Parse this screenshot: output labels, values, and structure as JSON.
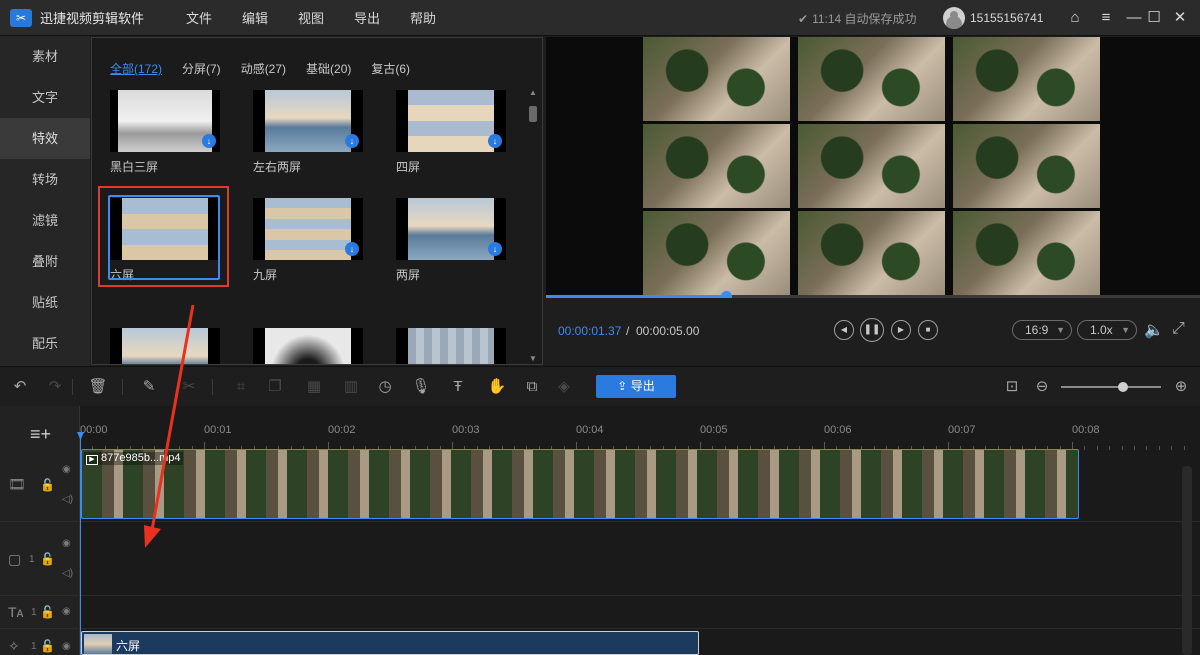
{
  "app": {
    "title": "迅捷视频剪辑软件"
  },
  "menu": [
    "文件",
    "编辑",
    "视图",
    "导出",
    "帮助"
  ],
  "status": {
    "save_time": "11:14",
    "save_text": "自动保存成功"
  },
  "user": {
    "name": "15155156741"
  },
  "sidebar": {
    "items": [
      "素材",
      "文字",
      "特效",
      "转场",
      "滤镜",
      "叠附",
      "贴纸",
      "配乐"
    ],
    "active_index": 2
  },
  "effects": {
    "tabs": [
      "全部(172)",
      "分屏(7)",
      "动感(27)",
      "基础(20)",
      "复古(6)"
    ],
    "active_tab": 0,
    "items": [
      {
        "label": "黑白三屏",
        "downloadable": true
      },
      {
        "label": "左右两屏",
        "downloadable": true
      },
      {
        "label": "四屏",
        "downloadable": true
      },
      {
        "label": "六屏",
        "downloadable": false,
        "selected": true
      },
      {
        "label": "九屏",
        "downloadable": true
      },
      {
        "label": "两屏",
        "downloadable": true
      }
    ]
  },
  "player": {
    "current_time": "00:00:01.37",
    "separator": "/",
    "total_time": "00:00:05.00",
    "progress_fraction": 0.275,
    "aspect_ratio": "16:9",
    "speed": "1.0x"
  },
  "toolbar": {
    "export_label": "导出",
    "zoom_level_fraction": 0.62,
    "accent_color": "#2a7ae0"
  },
  "timeline": {
    "ruler_labels": [
      "00:00",
      "00:01",
      "00:02",
      "00:03",
      "00:04",
      "00:05",
      "00:06",
      "00:07",
      "00:08"
    ],
    "video_clip_name": "877e985b...mp4",
    "effect_track_index": "1",
    "text_track_index": "1",
    "pip_track_index": "1",
    "effect_clip_name": "六屏"
  }
}
